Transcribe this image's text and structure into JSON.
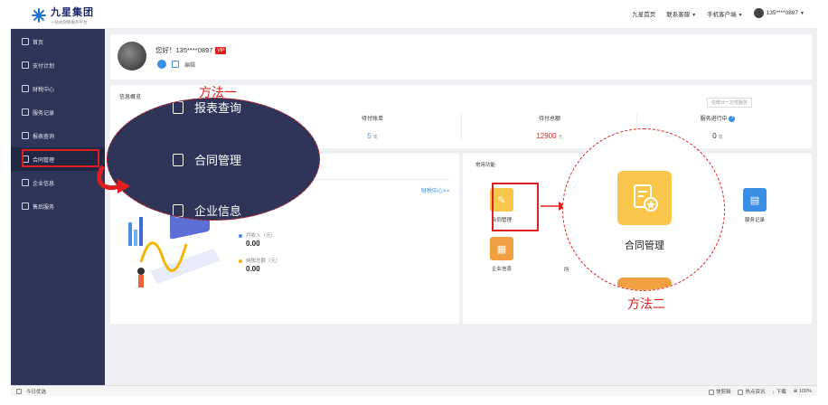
{
  "header": {
    "logo_title": "九星集团",
    "logo_subtitle": "一站式财税服务平台",
    "nav": [
      "九星首页",
      "联系客服",
      "手机客户端"
    ],
    "user": "135****0897"
  },
  "sidebar": {
    "items": [
      {
        "label": "首页",
        "icon": "home-icon"
      },
      {
        "label": "支付计划",
        "icon": "wallet-icon"
      },
      {
        "label": "财税中心",
        "icon": "layers-icon"
      },
      {
        "label": "服务记录",
        "icon": "record-icon"
      },
      {
        "label": "报表查询",
        "icon": "report-icon"
      },
      {
        "label": "合同管理",
        "icon": "contract-icon"
      },
      {
        "label": "企业信息",
        "icon": "building-icon"
      },
      {
        "label": "售后服务",
        "icon": "bell-icon"
      }
    ],
    "active_index": 5
  },
  "profile": {
    "greeting": "您好！135****0897",
    "vip_badge": "VIP",
    "edit_label": "编辑"
  },
  "overview": {
    "title": "信息概览",
    "tip": "仅统计一次性服务",
    "stats": [
      {
        "label": "待付账单",
        "value": "5",
        "unit": "笔",
        "color": "#3a8ee6"
      },
      {
        "label": "待付总额",
        "value": "12900",
        "unit": "元",
        "color": "#e02020"
      },
      {
        "label": "服务进行中",
        "value": "0",
        "unit": "笔",
        "color": "#333333"
      }
    ]
  },
  "finance": {
    "link": "财税中心>>",
    "monthly_income_label": "月收入（元）",
    "monthly_income_value": "0.00",
    "tax_total_label": "纳税总额（元）",
    "tax_total_value": "0.00"
  },
  "functions": {
    "title": "常用功能",
    "items": [
      {
        "label": "合同管理",
        "color": "#f9c64b",
        "icon": "contract-icon"
      },
      {
        "label": "企业信息",
        "color": "#f0a040",
        "icon": "building-icon"
      },
      {
        "label": "服务记录",
        "color": "#3a8ee6",
        "icon": "record-icon"
      }
    ],
    "partial_label": "所"
  },
  "zoom_left": {
    "rows": [
      "报表查询",
      "合同管理",
      "企业信息"
    ]
  },
  "zoom_right": {
    "label": "合同管理"
  },
  "annotations": {
    "method1": "方法一",
    "method2": "方法二"
  },
  "statusbar": {
    "left": "今日优选",
    "right": [
      "快剪辑",
      "热点资讯",
      "下载",
      "100%"
    ]
  }
}
